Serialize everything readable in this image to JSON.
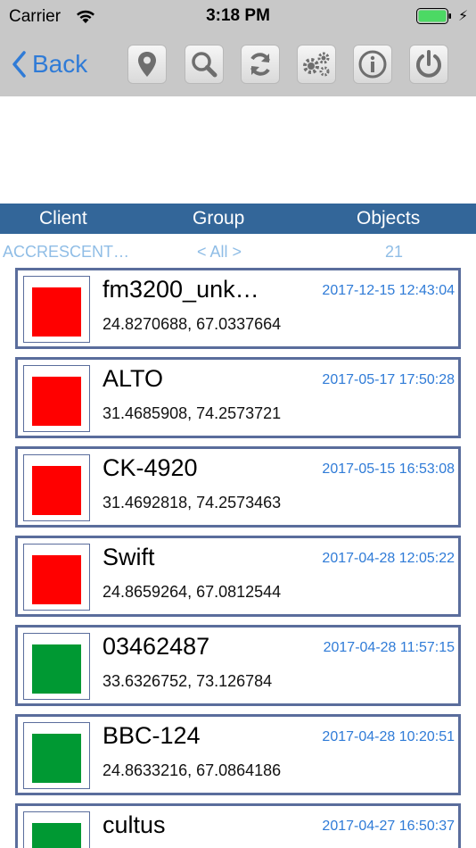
{
  "status_bar": {
    "carrier": "Carrier",
    "time": "3:18 PM",
    "battery_color": "#4cd964"
  },
  "toolbar": {
    "back_label": "Back",
    "icons": [
      "location-pin-icon",
      "search-icon",
      "refresh-icon",
      "settings-gears-icon",
      "info-icon",
      "power-icon"
    ]
  },
  "columns": {
    "client": "Client",
    "group": "Group",
    "objects": "Objects"
  },
  "filters": {
    "client": "ACCRESCENT…",
    "group": "< All >",
    "objects": "21"
  },
  "colors": {
    "accent": "#2f7bd7",
    "header_bg": "#336699",
    "red": "#ff0000",
    "green": "#009933",
    "row_border": "#5a6d9c"
  },
  "objects": [
    {
      "name": "fm3200_unk…",
      "coords": "24.8270688, 67.0337664",
      "time": "2017-12-15 12:43:04",
      "status_color": "#ff0000"
    },
    {
      "name": "ALTO",
      "coords": "31.4685908, 74.2573721",
      "time": "2017-05-17 17:50:28",
      "status_color": "#ff0000"
    },
    {
      "name": "CK-4920",
      "coords": "31.4692818, 74.2573463",
      "time": "2017-05-15 16:53:08",
      "status_color": "#ff0000"
    },
    {
      "name": "Swift",
      "coords": "24.8659264, 67.0812544",
      "time": "2017-04-28 12:05:22",
      "status_color": "#ff0000"
    },
    {
      "name": "03462487",
      "coords": "33.6326752, 73.126784",
      "time": "2017-04-28 11:57:15",
      "status_color": "#009933"
    },
    {
      "name": "BBC-124",
      "coords": "24.8633216, 67.0864186",
      "time": "2017-04-28 10:20:51",
      "status_color": "#009933"
    },
    {
      "name": "cultus",
      "coords": "",
      "time": "2017-04-27 16:50:37",
      "status_color": "#009933"
    }
  ]
}
